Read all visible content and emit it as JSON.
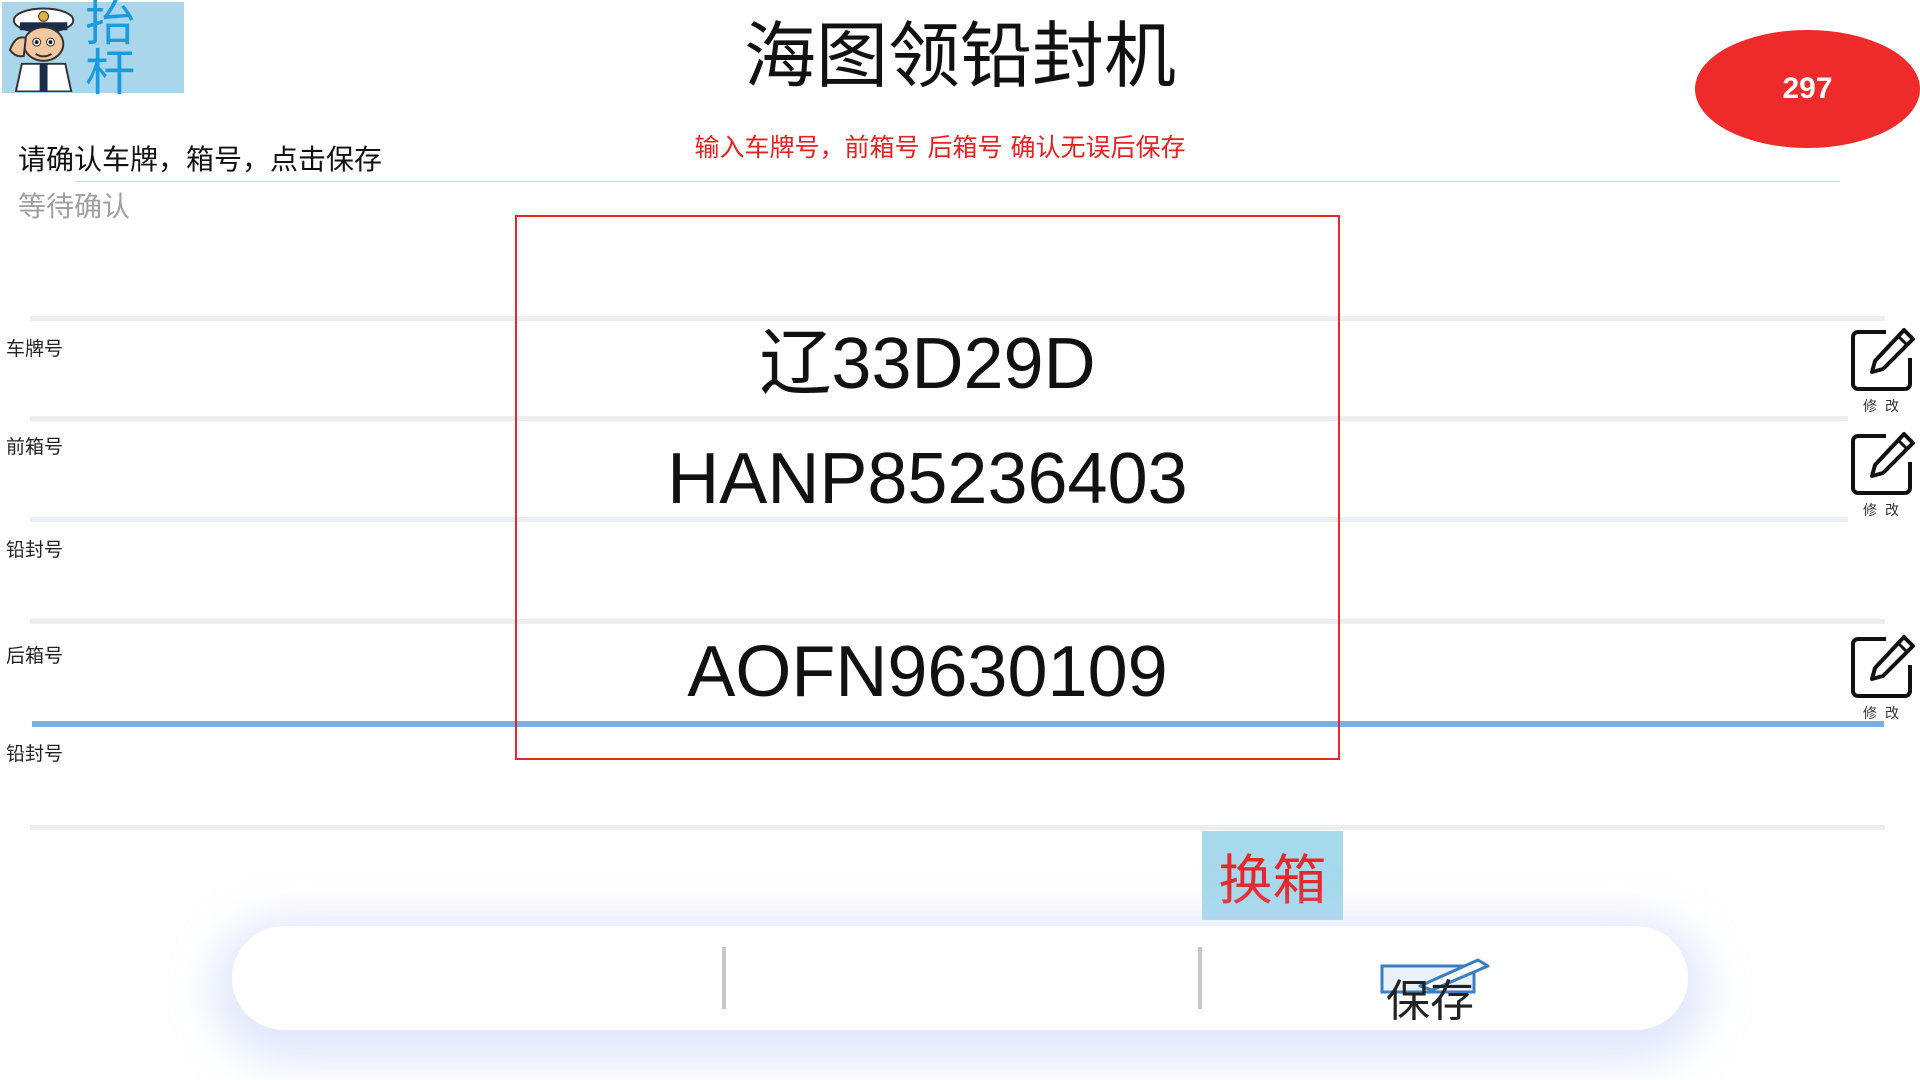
{
  "header": {
    "logo_text": "抬杆",
    "title": "海图领铅封机",
    "counter": "297"
  },
  "hint": "输入车牌号，前箱号 后箱号  确认无误后保存",
  "instruction": "请确认车牌，箱号，点击保存",
  "status": "等待确认",
  "rows": [
    {
      "label": "车牌号",
      "value": "辽33D29D",
      "editable": true
    },
    {
      "label": "前箱号",
      "value": "HANP85236403",
      "editable": true
    },
    {
      "label": "铅封号",
      "value": "",
      "editable": false
    },
    {
      "label": "后箱号",
      "value": "AOFN9630109",
      "editable": true
    },
    {
      "label": "铅封号",
      "value": "",
      "editable": false
    }
  ],
  "edit_label": "修改",
  "swap_button_label": "换箱",
  "save_button_label": "保存",
  "colors": {
    "accent_red": "#e8262b",
    "badge_red": "#ee2a2a",
    "swap_bg": "#a6d9ec",
    "focus_blue": "#79b0e3",
    "logo_bg": "#a9d6ea"
  }
}
